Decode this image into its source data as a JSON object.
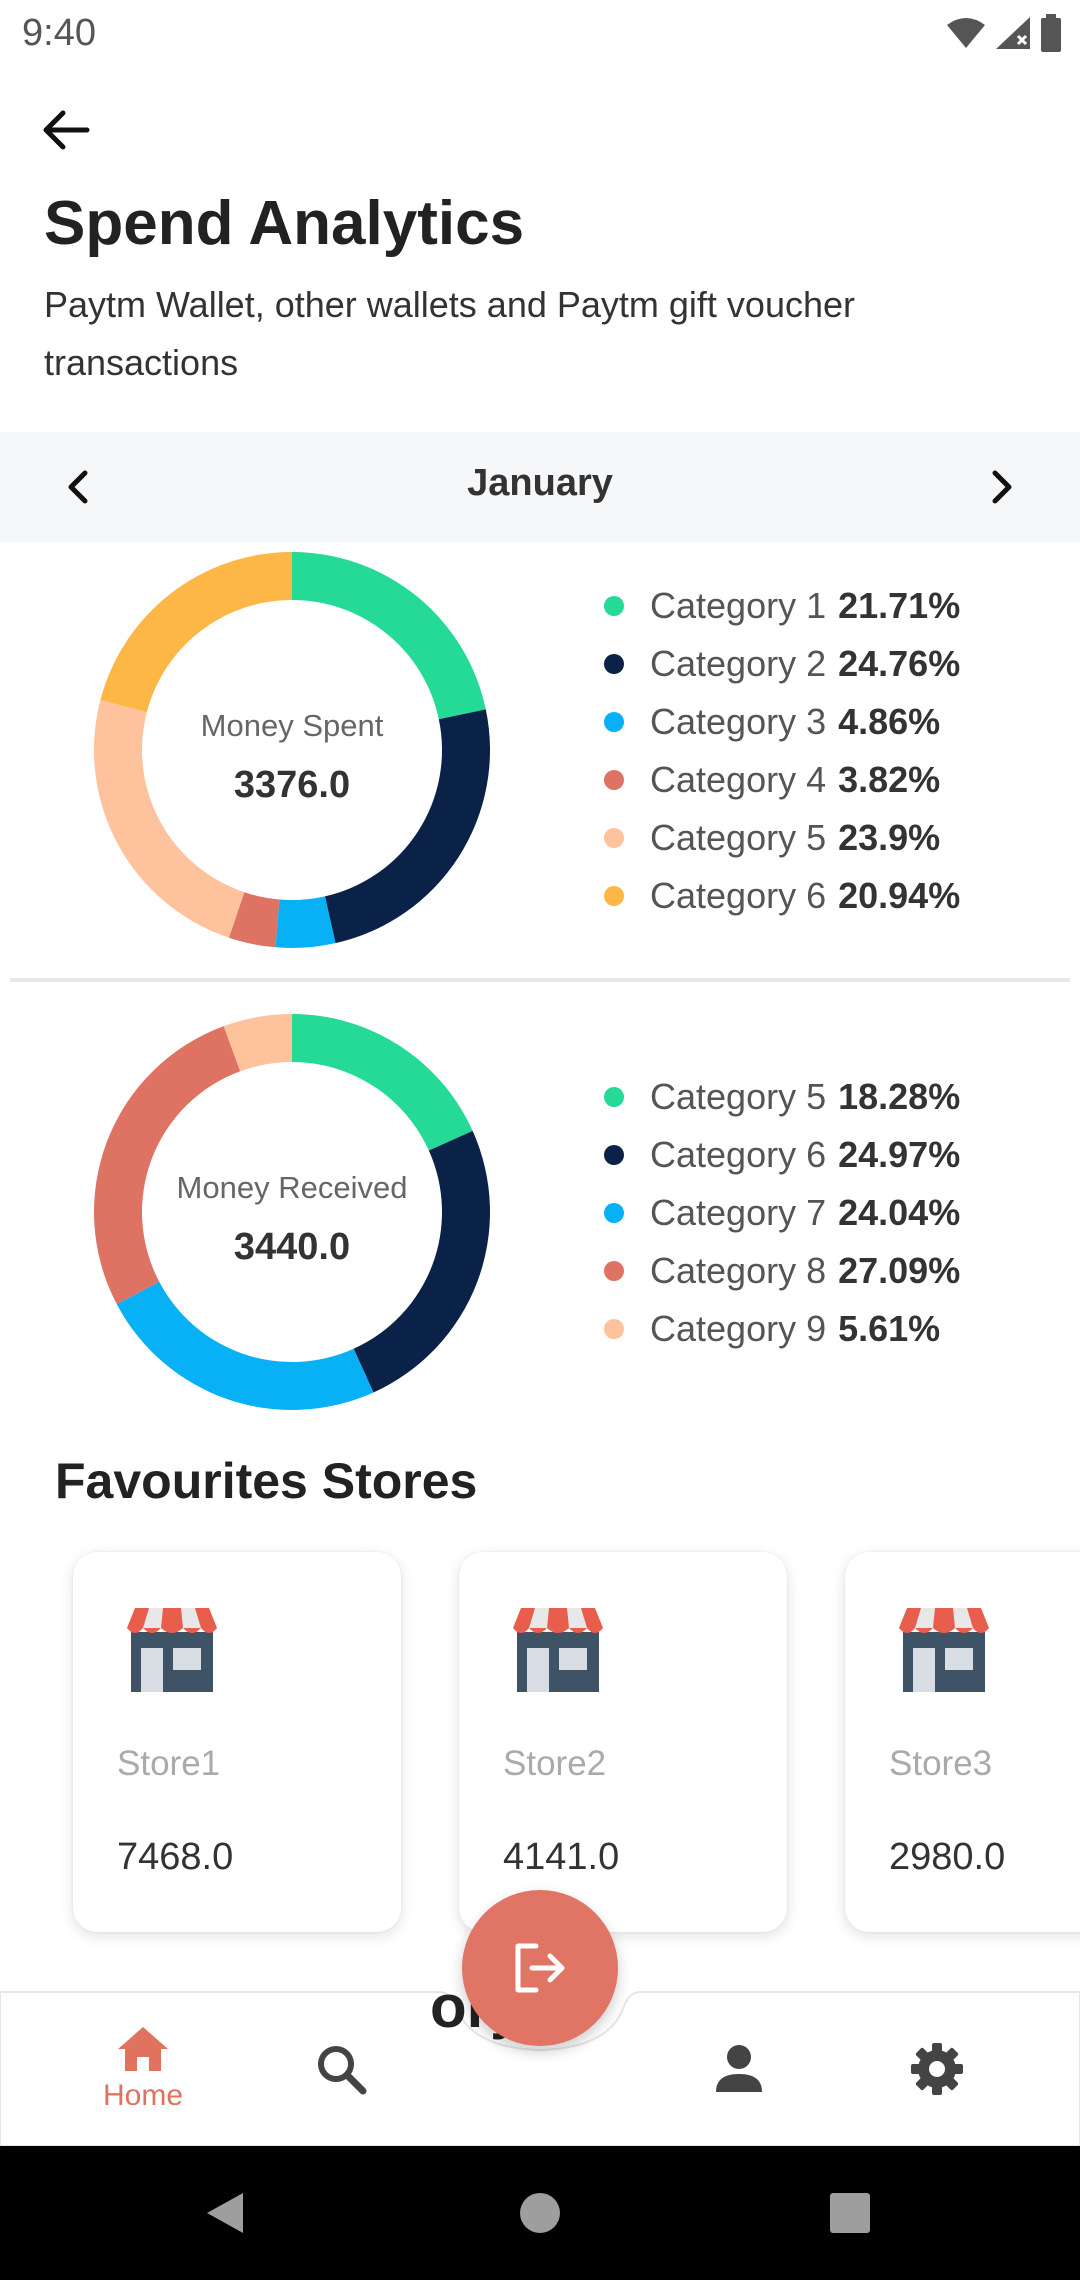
{
  "status_bar": {
    "time": "9:40",
    "icons": [
      "wifi-icon",
      "cell-signal-icon",
      "battery-icon"
    ]
  },
  "header": {
    "back_icon": "arrow-left-icon",
    "title": "Spend Analytics",
    "subtitle": "Paytm Wallet, other wallets and Paytm gift voucher transactions"
  },
  "month_selector": {
    "label": "January",
    "prev_icon": "chevron-left-icon",
    "next_icon": "chevron-right-icon"
  },
  "spent": {
    "label": "Money Spent",
    "value": "3376.0",
    "legend": [
      {
        "name": "Category 1",
        "pct": "21.71%",
        "color": "#25d997"
      },
      {
        "name": "Category 2",
        "pct": "24.76%",
        "color": "#0b2248"
      },
      {
        "name": "Category 3",
        "pct": "4.86%",
        "color": "#08b0f6"
      },
      {
        "name": "Category 4",
        "pct": "3.82%",
        "color": "#df7363"
      },
      {
        "name": "Category 5",
        "pct": "23.9%",
        "color": "#fec29c"
      },
      {
        "name": "Category 6",
        "pct": "20.94%",
        "color": "#fdb747"
      }
    ]
  },
  "received": {
    "label": "Money Received",
    "value": "3440.0",
    "legend": [
      {
        "name": "Category 5",
        "pct": "18.28%",
        "color": "#25d997"
      },
      {
        "name": "Category 6",
        "pct": "24.97%",
        "color": "#0b2248"
      },
      {
        "name": "Category 7",
        "pct": "24.04%",
        "color": "#08b0f6"
      },
      {
        "name": "Category 8",
        "pct": "27.09%",
        "color": "#df7363"
      },
      {
        "name": "Category 9",
        "pct": "5.61%",
        "color": "#fec29c"
      }
    ]
  },
  "chart_data": [
    {
      "type": "pie",
      "title": "Money Spent",
      "total": 3376.0,
      "categories": [
        "Category 1",
        "Category 2",
        "Category 3",
        "Category 4",
        "Category 5",
        "Category 6"
      ],
      "values": [
        21.71,
        24.76,
        4.86,
        3.82,
        23.9,
        20.94
      ],
      "colors": [
        "#25d997",
        "#0b2248",
        "#08b0f6",
        "#df7363",
        "#fec29c",
        "#fdb747"
      ],
      "legend": "right"
    },
    {
      "type": "pie",
      "title": "Money Received",
      "total": 3440.0,
      "categories": [
        "Category 5",
        "Category 6",
        "Category 7",
        "Category 8",
        "Category 9"
      ],
      "values": [
        18.28,
        24.97,
        24.04,
        27.09,
        5.61
      ],
      "colors": [
        "#25d997",
        "#0b2248",
        "#08b0f6",
        "#df7363",
        "#fec29c"
      ],
      "legend": "right"
    }
  ],
  "stores": {
    "title": "Favourites Stores",
    "items": [
      {
        "name": "Store1",
        "amount": "7468.0",
        "icon": "store-icon"
      },
      {
        "name": "Store2",
        "amount": "4141.0",
        "icon": "store-icon"
      },
      {
        "name": "Store3",
        "amount": "2980.0",
        "icon": "store-icon"
      }
    ]
  },
  "bottom_nav": {
    "home_label": "Home",
    "hidden_text": "ory",
    "items": [
      "home-icon",
      "search-icon",
      "logout-icon",
      "person-icon",
      "gear-icon"
    ],
    "accent": "#e07360"
  },
  "system_nav": {
    "items": [
      "back-triangle-icon",
      "home-circle-icon",
      "recents-square-icon"
    ]
  }
}
